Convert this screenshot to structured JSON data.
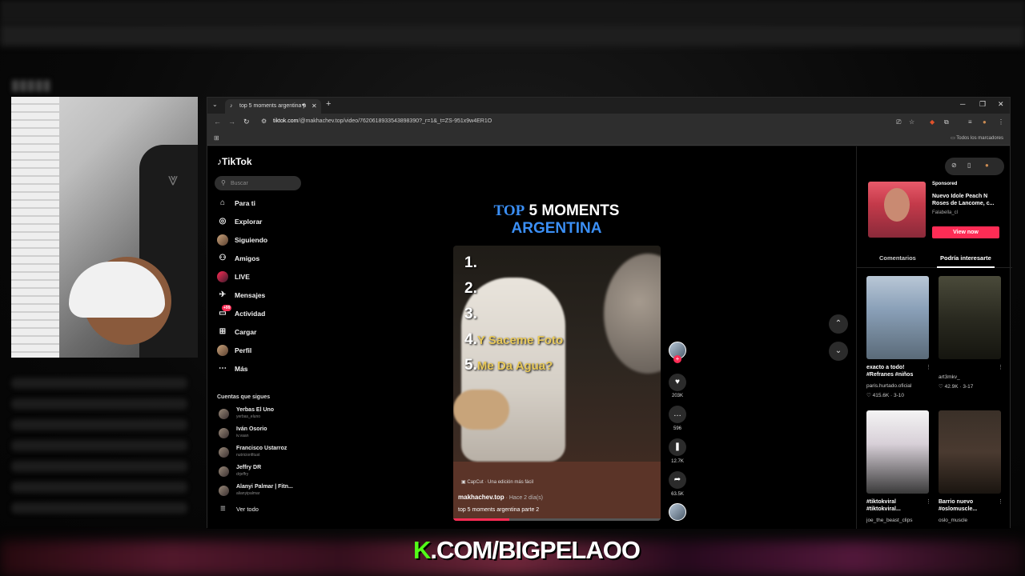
{
  "browser": {
    "tab_title": "top 5 moments argentina p",
    "url_domain": "tiktok.com",
    "url_path": "/@makhachev.top/video/7620618933543898390?_r=1&_t=ZS-951x9w4ER1O",
    "bookmarks_all": "Todos los marcadores"
  },
  "tiktok": {
    "logo": "TikTok",
    "search_placeholder": "Buscar",
    "nav": [
      {
        "label": "Para ti",
        "icon": "home-icon"
      },
      {
        "label": "Explorar",
        "icon": "compass-icon"
      },
      {
        "label": "Siguiendo",
        "icon": "following-avatar-icon"
      },
      {
        "label": "Amigos",
        "icon": "friends-icon"
      },
      {
        "label": "LIVE",
        "icon": "live-icon"
      },
      {
        "label": "Mensajes",
        "icon": "message-icon"
      },
      {
        "label": "Actividad",
        "icon": "activity-icon",
        "badge": "+99"
      },
      {
        "label": "Cargar",
        "icon": "upload-icon"
      },
      {
        "label": "Perfil",
        "icon": "profile-avatar-icon"
      },
      {
        "label": "Más",
        "icon": "more-icon"
      }
    ],
    "following_title": "Cuentas que sigues",
    "following": [
      {
        "name": "Yerbas El Uno",
        "user": "yerbas_eluno"
      },
      {
        "name": "Iván Osorio",
        "user": "iv.vaan"
      },
      {
        "name": "Francisco Ustarroz",
        "user": "nutricionfitust"
      },
      {
        "name": "Jeffry DR",
        "user": "drjeffry"
      },
      {
        "name": "Alanyi Palmar | Fitn...",
        "user": "alianyipalmar"
      }
    ],
    "see_all": "Ver todo"
  },
  "video": {
    "title_top": "TOP",
    "title_rest": "5 MOMENTS",
    "title_line2": "ARGENTINA",
    "list": [
      {
        "num": "1.",
        "text": ""
      },
      {
        "num": "2.",
        "text": ""
      },
      {
        "num": "3.",
        "text": ""
      },
      {
        "num": "4.",
        "text": "Y Saceme Foto"
      },
      {
        "num": "5.",
        "text": "Me Da Agua?"
      }
    ],
    "capcut": "CapCut · Una edición más fácil",
    "author": "makhachev.top",
    "time": " · Hace 2 día(s)",
    "description": "top 5 moments argentina parte 2",
    "progress": 0.27,
    "likes": "203K",
    "comments": "596",
    "saves": "12.7K",
    "shares": "63.5K"
  },
  "sidebar_right": {
    "sponsored": "Sponsored",
    "ad_title": "Nuevo Idole Peach N Roses de Lancome, c...",
    "ad_brand": "Falabella_cl",
    "ad_button": "View now",
    "tab_comments": "Comentarios",
    "tab_interest": "Podría interesarte",
    "cards": [
      {
        "title": "exacto a todo! #Refranes #niños",
        "user": "paris.hurtado.oficial",
        "stats": "♡ 415.6K · 3-10"
      },
      {
        "title": "",
        "user": "art3mkv_",
        "stats": "♡ 42.9K · 3-17"
      },
      {
        "title": "#tiktokviral #tiktokviral...",
        "user": "joe_the_beast_clips",
        "stats": ""
      },
      {
        "title": "Barrio nuevo #oslomuscle...",
        "user": "oslo_muscle",
        "stats": ""
      }
    ]
  },
  "overlay": {
    "k": "K",
    "rest": ".COM/BIGPELAOO"
  }
}
